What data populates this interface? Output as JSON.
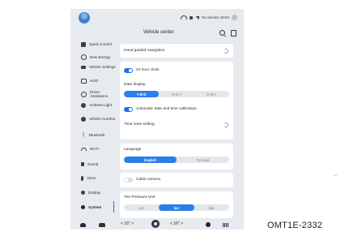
{
  "status": {
    "icons": [
      "wifi-icon",
      "lock-icon",
      "bluetooth-icon",
      "signal-icon"
    ],
    "text": "No service 10:04"
  },
  "header": {
    "title": "Vehicle center"
  },
  "sidebar": {
    "items": [
      {
        "label": "Quick Control",
        "icon": "quick-control-icon",
        "active": false
      },
      {
        "label": "New Energy",
        "icon": "new-energy-icon",
        "active": false
      },
      {
        "label": "Vehicle Settings",
        "icon": "vehicle-settings-icon",
        "active": false
      },
      {
        "label": "HUD",
        "icon": "hud-icon",
        "active": false
      },
      {
        "label": "Driver Assistance",
        "icon": "driver-assistance-icon",
        "active": false
      },
      {
        "label": "Ambient Light",
        "icon": "ambient-light-icon",
        "active": false
      },
      {
        "label": "Vehicle Comfort",
        "icon": "vehicle-comfort-icon",
        "active": false
      },
      {
        "label": "Bluetooth",
        "icon": "bluetooth-icon",
        "active": false
      },
      {
        "label": "Wi-Fi",
        "icon": "wifi-icon",
        "active": false
      },
      {
        "label": "Sound",
        "icon": "sound-icon",
        "active": false
      },
      {
        "label": "Voice",
        "icon": "voice-icon",
        "active": false
      },
      {
        "label": "Display",
        "icon": "display-icon",
        "active": false
      },
      {
        "label": "System",
        "icon": "system-icon",
        "active": true
      }
    ]
  },
  "main": {
    "hand_guided": "Hand guided navigation",
    "clock_24": "24 hour clock",
    "clock_24_on": true,
    "date_display_label": "Date display",
    "date_formats": [
      "Y-M-D",
      "M-D-Y",
      "D-M-Y"
    ],
    "date_selected": "Y-M-D",
    "auto_time": "Automatic date and time calibration",
    "auto_time_on": true,
    "time_zone": "Time zone setting",
    "language_label": "Language",
    "languages": [
      "English",
      "Русский"
    ],
    "language_selected": "English",
    "cabin_camera": "Cabin camera",
    "cabin_camera_on": false,
    "tire_label": "Tire Pressure Unit",
    "tire_units": [
      "psi",
      "bar",
      "kpa"
    ],
    "tire_selected": "bar"
  },
  "bottombar": {
    "left_temp": "16°",
    "right_temp": "16°"
  },
  "caption": "OMT1E-2332",
  "colors": {
    "accent": "#2d7ee8",
    "background": "#e7eaee",
    "card": "#ffffff"
  }
}
